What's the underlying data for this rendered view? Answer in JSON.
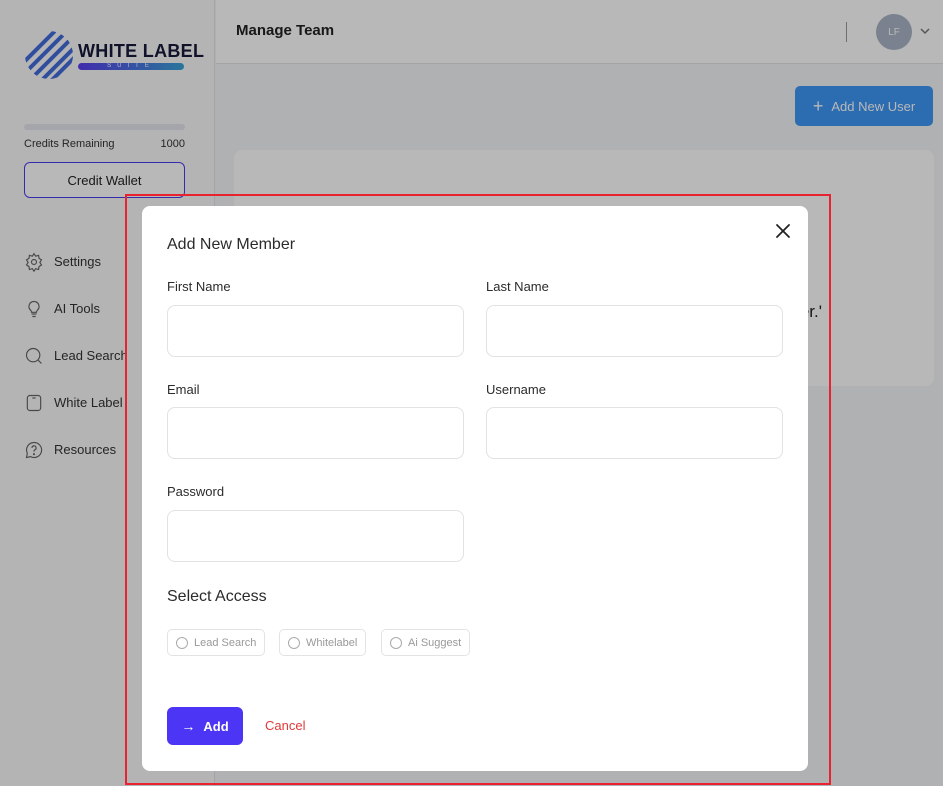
{
  "brand": {
    "title": "WHITE LABEL",
    "subtitle": "SUITE"
  },
  "credits": {
    "label": "Credits Remaining",
    "value": "1000"
  },
  "sidebar": {
    "wallet_label": "Credit Wallet",
    "items": [
      {
        "label": "Settings",
        "icon": "gear-icon"
      },
      {
        "label": "AI Tools",
        "icon": "lightbulb-icon"
      },
      {
        "label": "Lead Search",
        "icon": "search-icon"
      },
      {
        "label": "White Label",
        "icon": "tablet-icon"
      },
      {
        "label": "Resources",
        "icon": "help-icon"
      }
    ]
  },
  "header": {
    "title": "Manage Team",
    "avatar_initials": "LF"
  },
  "main": {
    "add_user_label": "Add New User",
    "partial_text": "er.'"
  },
  "modal": {
    "title": "Add New Member",
    "fields": {
      "first_name": {
        "label": "First Name",
        "value": ""
      },
      "last_name": {
        "label": "Last Name",
        "value": ""
      },
      "email": {
        "label": "Email",
        "value": ""
      },
      "username": {
        "label": "Username",
        "value": ""
      },
      "password": {
        "label": "Password",
        "value": ""
      }
    },
    "access_title": "Select Access",
    "access_options": [
      "Lead Search",
      "Whitelabel",
      "Ai Suggest"
    ],
    "add_label": "Add",
    "cancel_label": "Cancel"
  },
  "colors": {
    "accent": "#4c35f5",
    "primary_blue": "#3d97f5",
    "cancel": "#e03a3a",
    "highlight": "#e8232f"
  }
}
